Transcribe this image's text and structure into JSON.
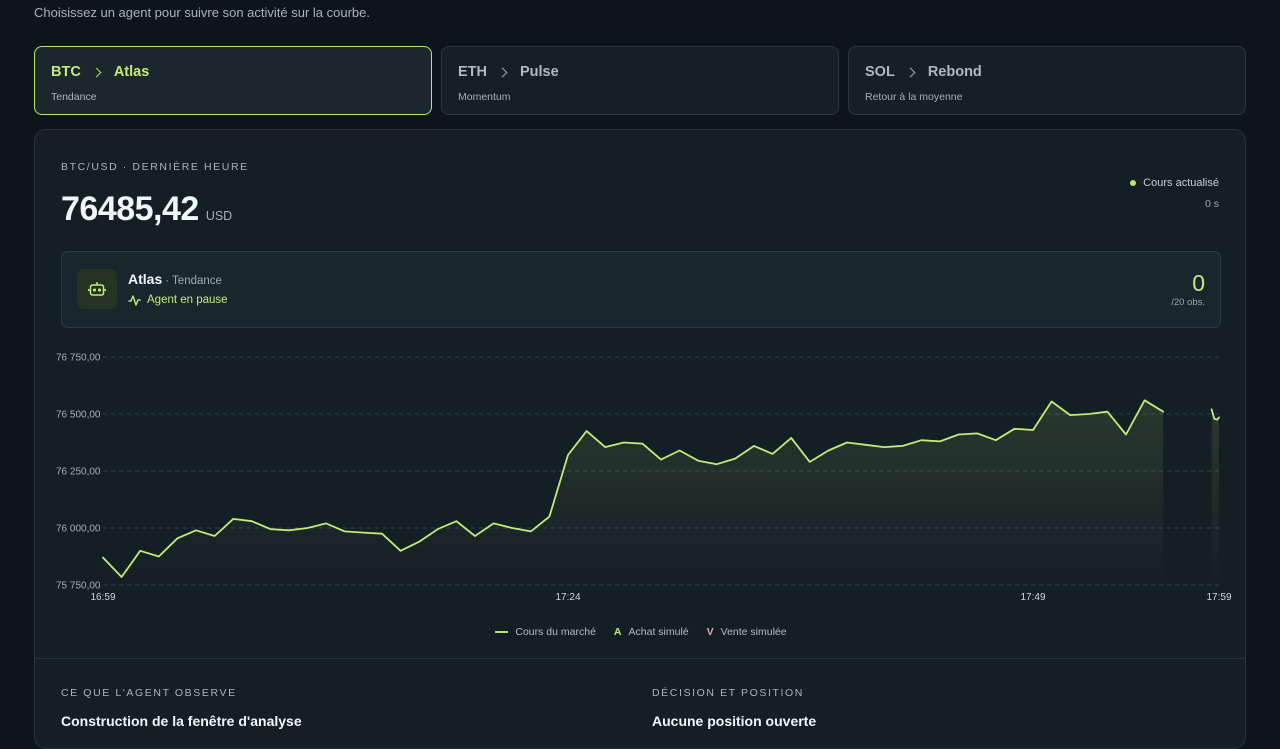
{
  "subtitle": "Choisissez un agent pour suivre son activité sur la courbe.",
  "agents": [
    {
      "symbol": "BTC",
      "name": "Atlas",
      "strategy": "Tendance"
    },
    {
      "symbol": "ETH",
      "name": "Pulse",
      "strategy": "Momentum"
    },
    {
      "symbol": "SOL",
      "name": "Rebond",
      "strategy": "Retour à la moyenne"
    }
  ],
  "active_agent_index": 0,
  "market": {
    "pair_label": "BTC/USD · DERNIÈRE HEURE",
    "price": "76485,42",
    "currency": "USD",
    "status_text": "Cours actualisé",
    "status_age": "0 s"
  },
  "agent_panel": {
    "name": "Atlas",
    "strategy": "· Tendance",
    "state": "Agent en pause",
    "obs_count": "0",
    "obs_total": "/20 obs."
  },
  "legend": {
    "market": "Cours du marché",
    "buy_marker": "A",
    "buy": "Achat simulé",
    "sell_marker": "V",
    "sell": "Vente simulée"
  },
  "sections": {
    "observe_title": "CE QUE L'AGENT OBSERVE",
    "observe_body": "Construction de la fenêtre d'analyse",
    "decision_title": "DÉCISION ET POSITION",
    "decision_body": "Aucune position ouverte"
  },
  "colors": {
    "accent": "#b8e86a",
    "sell": "#f0a0a8"
  },
  "chart_data": {
    "type": "line",
    "x_ticks": [
      "16:59",
      "17:24",
      "17:49",
      "17:59"
    ],
    "y_ticks": [
      "76 750,00",
      "76 500,00",
      "76 250,00",
      "76 000,00",
      "75 750,00"
    ],
    "ylim": [
      75750,
      76750
    ],
    "xlim_minutes": [
      0,
      60
    ],
    "grid": true,
    "series": [
      {
        "name": "Cours du marché",
        "x_minutes": [
          0,
          1,
          2,
          3,
          4,
          5,
          6,
          7,
          8,
          9,
          10,
          11,
          12,
          13,
          14,
          15,
          16,
          17,
          18,
          19,
          20,
          21,
          22,
          23,
          24,
          25,
          26,
          27,
          28,
          29,
          30,
          31,
          32,
          33,
          34,
          35,
          36,
          37,
          38,
          39,
          40,
          41,
          42,
          43,
          44,
          45,
          46,
          47,
          48,
          49,
          50,
          51,
          52,
          53,
          54,
          55,
          56,
          57
        ],
        "values": [
          75870,
          75785,
          75900,
          75875,
          75955,
          75990,
          75965,
          76040,
          76030,
          75995,
          75990,
          76000,
          76020,
          75985,
          75980,
          75975,
          75900,
          75940,
          75995,
          76030,
          75965,
          76020,
          76000,
          75985,
          76050,
          76320,
          76425,
          76355,
          76375,
          76370,
          76300,
          76340,
          76295,
          76280,
          76305,
          76360,
          76325,
          76395,
          76290,
          76340,
          76375,
          76365,
          76355,
          76360,
          76385,
          76380,
          76410,
          76415,
          76385,
          76435,
          76430,
          76555,
          76495,
          76500,
          76510,
          76410,
          76560,
          76510
        ]
      },
      {
        "name": "",
        "x_minutes": [
          59.6,
          59.75,
          59.9,
          60
        ],
        "values": [
          76520,
          76480,
          76475,
          76485
        ]
      }
    ]
  }
}
